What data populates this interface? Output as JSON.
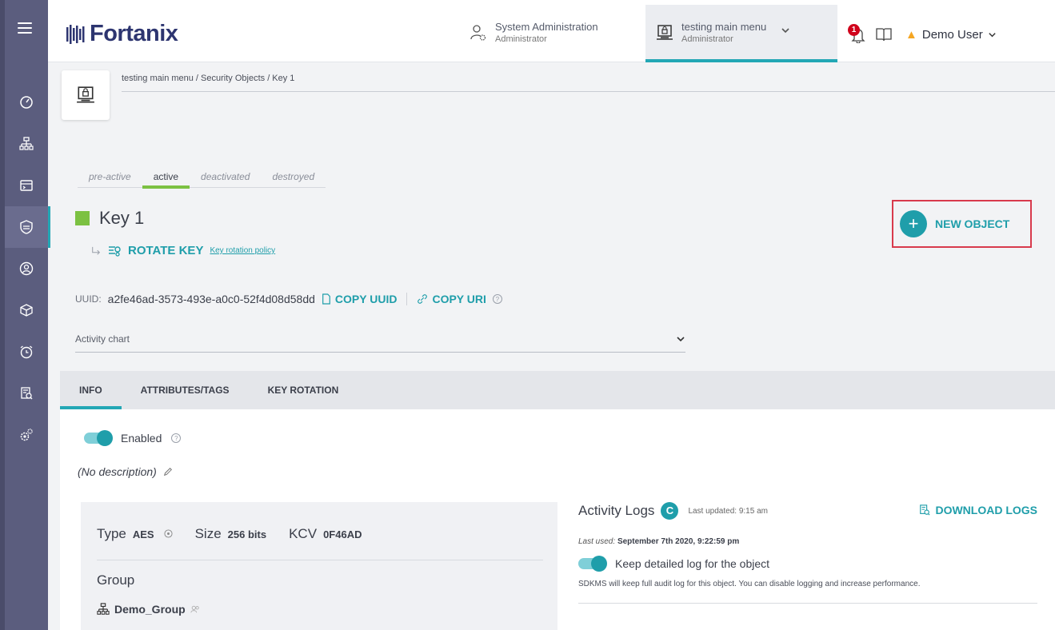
{
  "header": {
    "brand": "Fortanix",
    "system_account": {
      "title": "System Administration",
      "role": "Administrator"
    },
    "app_account": {
      "title": "testing main menu",
      "role": "Administrator"
    },
    "notifications_count": "1",
    "user_name": "Demo User"
  },
  "breadcrumb": "testing main menu / Security Objects / Key 1",
  "states": [
    "pre-active",
    "active",
    "deactivated",
    "destroyed"
  ],
  "key": {
    "name": "Key 1",
    "rotate_label": "ROTATE KEY",
    "rotation_policy_link": "Key rotation policy",
    "uuid_label": "UUID:",
    "uuid": "a2fe46ad-3573-493e-a0c0-52f4d08d58dd",
    "copy_uuid": "COPY UUID",
    "copy_uri": "COPY URI"
  },
  "new_object_label": "NEW OBJECT",
  "activity_chart_label": "Activity chart",
  "tabs": [
    "INFO",
    "ATTRIBUTES/TAGS",
    "KEY ROTATION"
  ],
  "info": {
    "enabled_label": "Enabled",
    "description": "(No description)",
    "type_label": "Type",
    "type_value": "AES",
    "size_label": "Size",
    "size_value": "256 bits",
    "kcv_label": "KCV",
    "kcv_value": "0F46AD",
    "group_label": "Group",
    "group_value": "Demo_Group"
  },
  "logs": {
    "title": "Activity Logs",
    "refresh_glyph": "C",
    "last_updated": "Last updated: 9:15 am",
    "download": "DOWNLOAD LOGS",
    "last_used_label": "Last used:",
    "last_used_value": "September 7th 2020, 9:22:59 pm",
    "keep_label": "Keep detailed log for the object",
    "note": "SDKMS will keep full audit log for this object. You can disable logging and increase performance."
  },
  "colors": {
    "accent": "#1f9eaa",
    "active_state": "#7cc142",
    "nav": "#5b5d7e",
    "highlight_border": "#d83a4c"
  }
}
